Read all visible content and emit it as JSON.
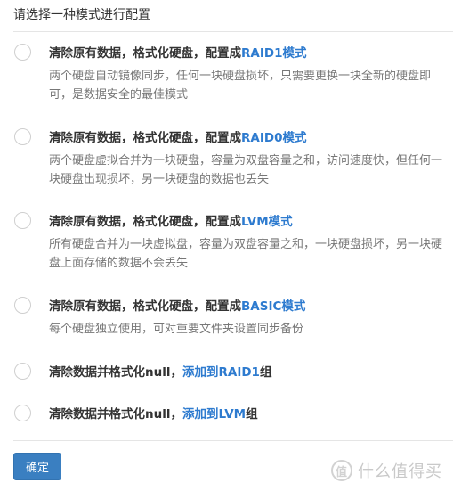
{
  "header": {
    "title": "请选择一种模式进行配置"
  },
  "options": [
    {
      "title_prefix": "清除原有数据，格式化硬盘，配置成",
      "title_accent": "RAID1模式",
      "title_suffix": "",
      "description": "两个硬盘自动镜像同步，任何一块硬盘损坏，只需要更换一块全新的硬盘即可，是数据安全的最佳模式"
    },
    {
      "title_prefix": "清除原有数据，格式化硬盘，配置成",
      "title_accent": "RAID0模式",
      "title_suffix": "",
      "description": "两个硬盘虚拟合并为一块硬盘，容量为双盘容量之和，访问速度快，但任何一块硬盘出现损坏，另一块硬盘的数据也丢失"
    },
    {
      "title_prefix": "清除原有数据，格式化硬盘，配置成",
      "title_accent": "LVM模式",
      "title_suffix": "",
      "description": "所有硬盘合并为一块虚拟盘，容量为双盘容量之和，一块硬盘损坏，另一块硬盘上面存储的数据不会丢失"
    },
    {
      "title_prefix": "清除原有数据，格式化硬盘，配置成",
      "title_accent": "BASIC模式",
      "title_suffix": "",
      "description": "每个硬盘独立使用，可对重要文件夹设置同步备份"
    },
    {
      "title_prefix": "清除数据并格式化null，",
      "title_accent": "添加到RAID1",
      "title_suffix": "组",
      "description": ""
    },
    {
      "title_prefix": "清除数据并格式化null，",
      "title_accent": "添加到LVM",
      "title_suffix": "组",
      "description": ""
    }
  ],
  "footer": {
    "confirm_label": "确定"
  },
  "watermark": {
    "logo_char": "值",
    "text": "什么值得买"
  },
  "colors": {
    "accent": "#2e7bcf",
    "button": "#3a7fc1",
    "description": "#777777"
  }
}
